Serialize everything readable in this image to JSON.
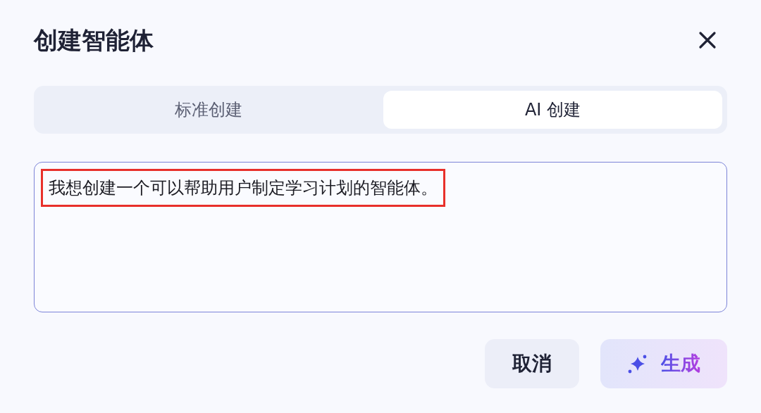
{
  "dialog": {
    "title": "创建智能体"
  },
  "tabs": [
    {
      "label": "标准创建",
      "selected": false
    },
    {
      "label": "AI 创建",
      "selected": true
    }
  ],
  "prompt": {
    "value": "我想创建一个可以帮助用户制定学习计划的智能体。",
    "highlighted": true
  },
  "buttons": [
    {
      "kind": "secondary",
      "label": "取消"
    },
    {
      "kind": "primary",
      "label": "生成"
    }
  ]
}
